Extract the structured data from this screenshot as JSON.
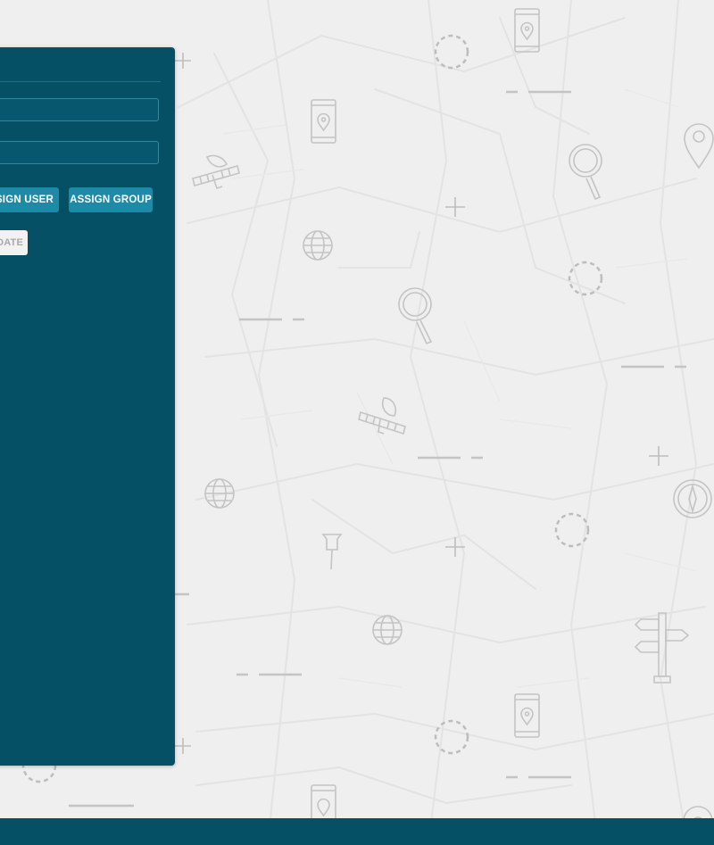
{
  "panel": {
    "field_1_value": "",
    "field_2_value": "",
    "assign_user_label": "ASSIGN USER",
    "assign_group_label": "ASSIGN GROUP",
    "update_label": "UPDATE"
  },
  "icons": {
    "background": [
      "map-pin-icon",
      "phone-map-icon",
      "magnifier-icon",
      "satellite-icon",
      "globe-icon",
      "compass-icon",
      "push-pin-icon",
      "signpost-icon",
      "plus-icon",
      "dashed-circle-icon"
    ]
  },
  "colors": {
    "panel": "#055065",
    "button": "#1d8ba8",
    "input_border": "#2d8aa6",
    "background": "#efefef",
    "footer": "#055065"
  }
}
